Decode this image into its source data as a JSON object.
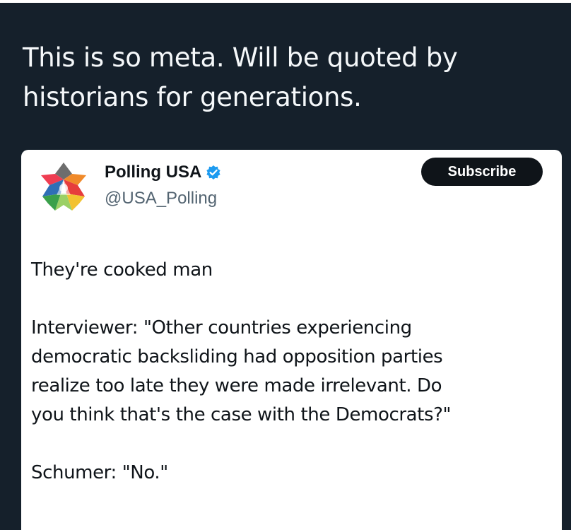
{
  "post": {
    "caption_lines": [
      "This is so meta. Will be quoted by",
      "historians for generations."
    ]
  },
  "quoted_tweet": {
    "display_name": "Polling USA",
    "handle": "@USA_Polling",
    "verified": true,
    "subscribe_label": "Subscribe",
    "body": {
      "paragraph_1": "They're cooked man",
      "paragraph_2_lines": [
        "Interviewer: \"Other countries experiencing",
        "democratic backsliding had opposition parties",
        "realize too late they were made irrelevant. Do",
        "you think that's the case with the Democrats?\""
      ],
      "paragraph_3": "Schumer: \"No.\""
    }
  },
  "colors": {
    "background": "#15202b",
    "card": "#ffffff",
    "verified_badge": "#1d9bf0",
    "text_primary": "#0f1419",
    "text_secondary": "#536471",
    "button_bg": "#0f1419"
  },
  "icons": {
    "avatar": "polling-usa-logo",
    "verified": "verified-badge-icon"
  }
}
